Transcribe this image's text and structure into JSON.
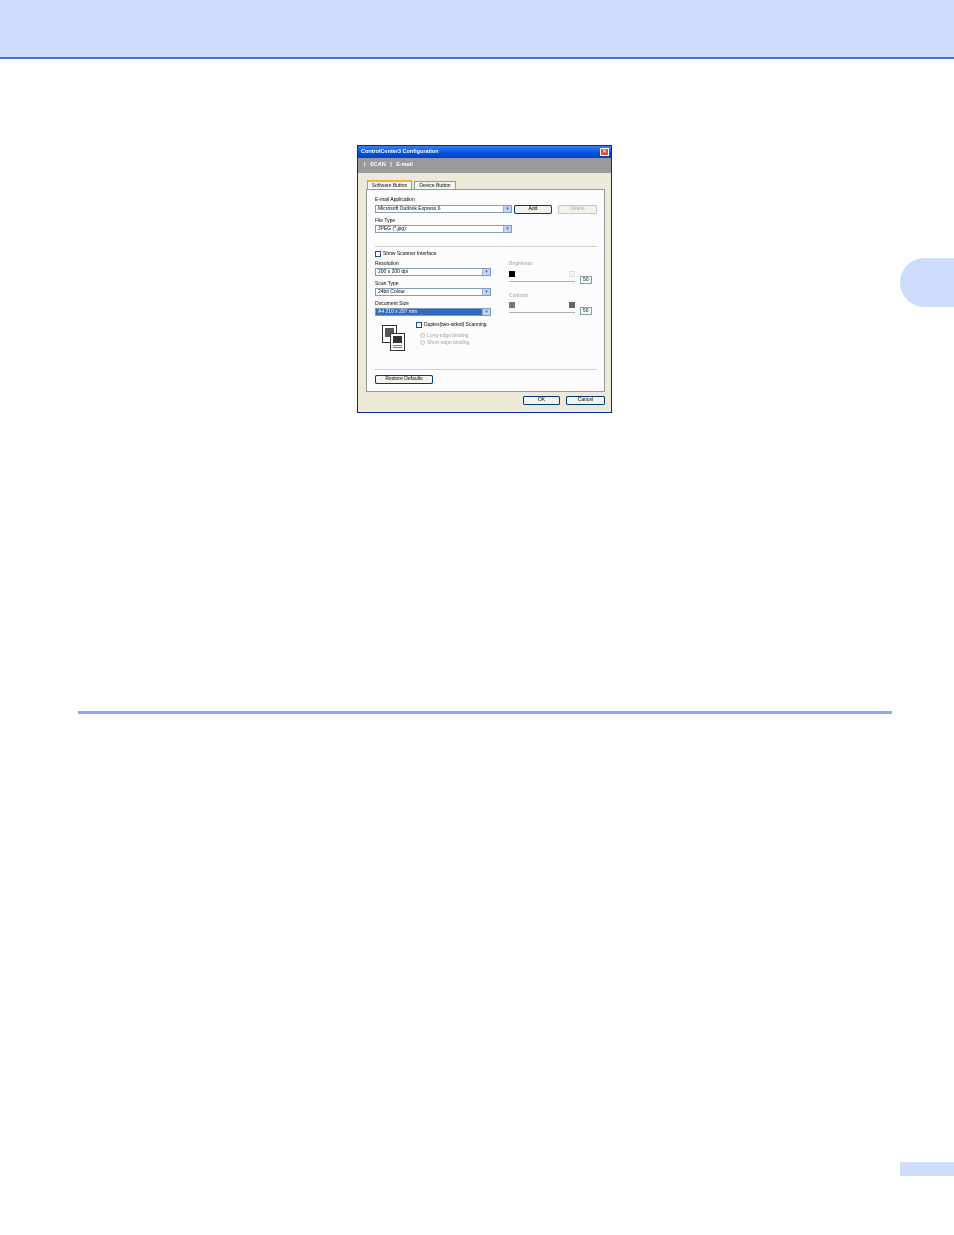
{
  "dialog": {
    "title": "ControlCenter3 Configuration",
    "close_glyph": "✕",
    "band": {
      "sep1": "|",
      "scan": "SCAN",
      "sep2": "|",
      "email": "E-mail"
    },
    "tabs": [
      "Software Button",
      "Device Button"
    ],
    "email_application": {
      "label": "E-mail Application",
      "value": "Microsoft Outlook Express 6"
    },
    "add_button": "Add",
    "delete_button": "Delete",
    "file_type": {
      "label": "File Type",
      "value": "JPEG (*.jpg)"
    },
    "show_scanner_interface": "Show Scanner Interface",
    "resolution": {
      "label": "Resolution",
      "value": "200 x 200 dpi"
    },
    "scan_type": {
      "label": "Scan Type",
      "value": "24bit Colour"
    },
    "document_size": {
      "label": "Document Size",
      "value": "A4 210 x 297 mm"
    },
    "duplex": "Duplex(two-sided) Scanning",
    "long_edge": "Long-edge binding",
    "short_edge": "Short-edge binding",
    "brightness": {
      "label": "Brightness",
      "value": "50",
      "level": 0.5
    },
    "contrast": {
      "label": "Contrast",
      "value": "50",
      "level": 0.5
    },
    "restore_defaults": "Restore Defaults",
    "ok_button": "OK",
    "cancel_button": "Cancel"
  },
  "colors": {
    "header": "#ccdcfa",
    "rule": "#8aa8ee",
    "title_bar": "#0050e0"
  }
}
